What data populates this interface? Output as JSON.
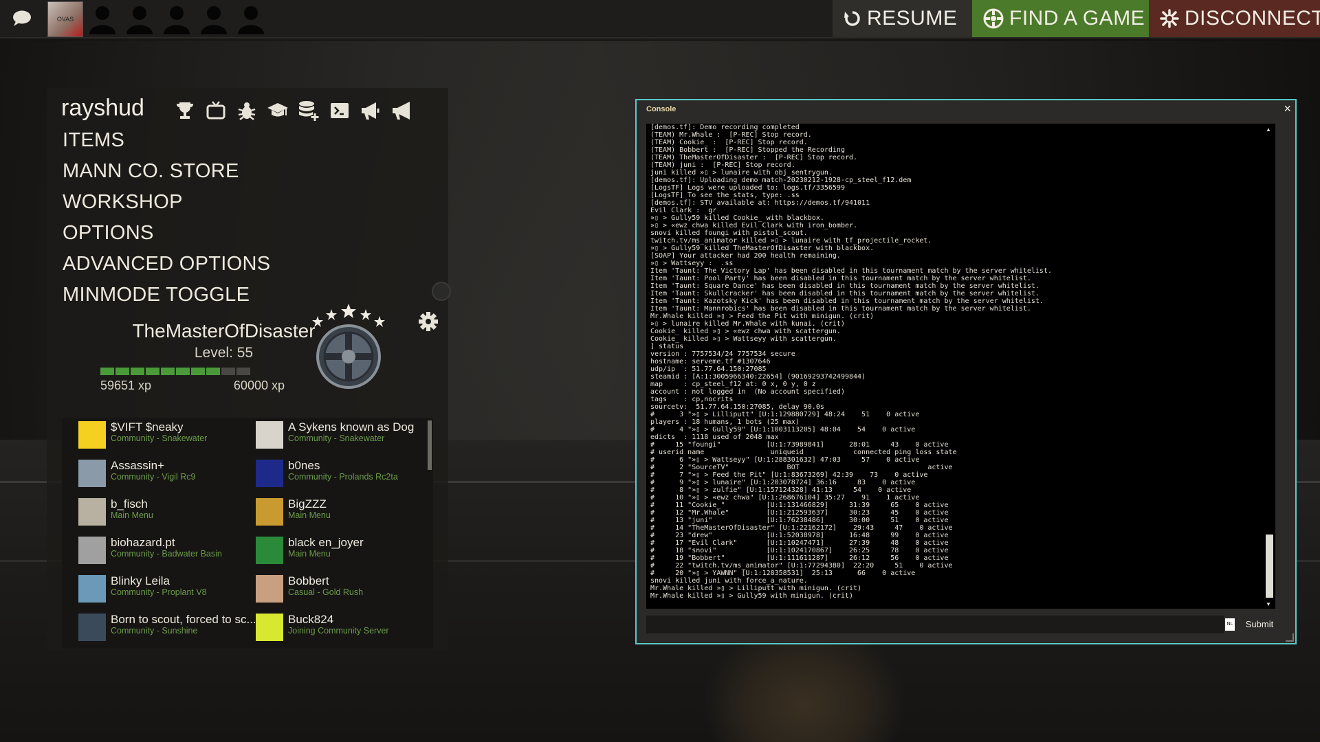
{
  "topbar": {
    "resume_label": "RESUME",
    "find_game_label": "FIND A GAME",
    "disconnect_label": "DISCONNECT",
    "avatar_text": "OVAS",
    "colors": {
      "resume": "#2f2e2b",
      "find": "#4a7a2a",
      "disconnect": "#5a2a22"
    }
  },
  "menu": {
    "username": "rayshud",
    "icons": [
      "trophy-icon",
      "tv-icon",
      "bug-icon",
      "graduation-cap-icon",
      "database-add-icon",
      "terminal-icon",
      "megaphone-icon",
      "megaphone-alt-icon"
    ],
    "items": [
      "ITEMS",
      "MANN CO. STORE",
      "WORKSHOP",
      "OPTIONS",
      "ADVANCED OPTIONS",
      "MINMODE TOGGLE"
    ]
  },
  "player": {
    "name": "TheMasterOfDisaster",
    "level": "Level: 55",
    "xp_current": "59651 xp",
    "xp_next": "60000 xp",
    "xp_progress": 0.8,
    "xp_segments": 10
  },
  "friends": [
    {
      "name": "$VIFT $neaky",
      "status": "Community - Snakewater",
      "avatar_color": "#f5d020"
    },
    {
      "name": "A Sykens known as Dog",
      "status": "Community - Snakewater",
      "avatar_color": "#d8d4cc"
    },
    {
      "name": "Assassin+",
      "status": "Community - Vigil Rc9",
      "avatar_color": "#8a9aa8"
    },
    {
      "name": "b0nes",
      "status": "Community - Prolands Rc2ta",
      "avatar_color": "#1e2a8a"
    },
    {
      "name": "b_fisch",
      "status": "Main Menu",
      "avatar_color": "#b8b0a0"
    },
    {
      "name": "BigZZZ",
      "status": "Main Menu",
      "avatar_color": "#c89a30"
    },
    {
      "name": "biohazard.pt",
      "status": "Community - Badwater Basin",
      "avatar_color": "#a0a0a0"
    },
    {
      "name": "black en_joyer",
      "status": "Main Menu",
      "avatar_color": "#2a8a3a"
    },
    {
      "name": "Blinky Leila",
      "status": "Community - Proplant V8",
      "avatar_color": "#6a9ab8"
    },
    {
      "name": "Bobbert",
      "status": "Casual - Gold Rush",
      "avatar_color": "#c8a080"
    },
    {
      "name": "Born to scout, forced to sc...",
      "status": "Community - Sunshine",
      "avatar_color": "#3a4a5a"
    },
    {
      "name": "Buck824",
      "status": "Joining Community Server",
      "avatar_color": "#d8e830"
    }
  ],
  "console": {
    "title": "Console",
    "close": "×",
    "nl_label": "NL",
    "submit_label": "Submit",
    "lines": [
      "[demos.tf]: Demo recording completed",
      "(TEAM) Mr.Whale :  [P-REC] Stop record.",
      "(TEAM) Cookie_ :  [P-REC] Stop record.",
      "(TEAM) Bobbert :  [P-REC] Stopped the Recording",
      "(TEAM) TheMasterOfDisaster :  [P-REC] Stop record.",
      "(TEAM) juni :  [P-REC] Stop record.",
      "juni killed »▯ > lunaire with obj_sentrygun.",
      "[demos.tf]: Uploading demo match-20230212-1928-cp_steel_f12.dem",
      "[LogsTF] Logs were uploaded to: logs.tf/3356599",
      "[LogsTF] To see the stats, type: .ss",
      "[demos.tf]: STV available at: https://demos.tf/941011",
      "Evil Clark :  gr",
      "»▯ > Gully59 killed Cookie_ with blackbox.",
      "»▯ > «ewz chwa killed Evil Clark with iron_bomber.",
      "snovi killed foungi with pistol_scout.",
      "twitch.tv/ms_animator killed »▯ > lunaire with tf_projectile_rocket.",
      "»▯ > Gully59 killed TheMasterOfDisaster with blackbox.",
      "[SOAP] Your attacker had 200 health remaining.",
      "»▯ > Wattseyy :  .ss",
      "Item 'Taunt: The Victory Lap' has been disabled in this tournament match by the server whitelist.",
      "Item 'Taunt: Pool Party' has been disabled in this tournament match by the server whitelist.",
      "Item 'Taunt: Square Dance' has been disabled in this tournament match by the server whitelist.",
      "Item 'Taunt: Skullcracker' has been disabled in this tournament match by the server whitelist.",
      "Item 'Taunt: Kazotsky Kick' has been disabled in this tournament match by the server whitelist.",
      "Item 'Taunt: Mannrobics' has been disabled in this tournament match by the server whitelist.",
      "Mr.Whale killed »▯ > Feed the Pit with minigun. (crit)",
      "»▯ > lunaire killed Mr.Whale with kunai. (crit)",
      "Cookie_ killed »▯ > «ewz chwa with scattergun.",
      "Cookie_ killed »▯ > Wattseyy with scattergun.",
      "] status",
      "version : 7757534/24 7757534 secure",
      "hostname: serveme.tf #1307646",
      "udp/ip  : 51.77.64.150:27085",
      "steamid : [A:1:3005966340:22654] (90169293742499844)",
      "map     : cp_steel_f12 at: 0 x, 0 y, 0 z",
      "account : not logged in  (No account specified)",
      "tags    : cp,nocrits",
      "sourcetv:  51.77.64.150:27085, delay 90.0s",
      "#      3 \"»▯ > Lilliputt\" [U:1:129880729] 48:24    51    0 active",
      "players : 18 humans, 1 bots (25 max)",
      "#      4 \"»▯ > Gully59\" [U:1:1003113205] 48:04    54    0 active",
      "edicts  : 1118 used of 2048 max",
      "#     15 \"foungi\"           [U:1:73989841]      28:01     43    0 active",
      "# userid name                uniqueid            connected ping loss state",
      "#      6 \"»▯ > Wattseyy\" [U:1:288301632] 47:03     57    0 active",
      "#      2 \"SourceTV\"              BOT                               active",
      "#      7 \"»▯ > Feed the Pit\" [U:1:83673269] 42:39    73    0 active",
      "#      9 \"»▯ > lunaire\" [U:1:203078724] 36:16     83    0 active",
      "#      8 \"»▯ > zulfie\" [U:1:157124328] 41:13     54    0 active",
      "#     10 \"»▯ > «ewz chwa\" [U:1:268676104] 35:27    91    1 active",
      "#     11 \"Cookie_\"          [U:1:131466829]     31:39     65    0 active",
      "#     12 \"Mr.Whale\"         [U:1:212593637]     30:23     45    0 active",
      "#     13 \"juni\"             [U:1:76238486]      30:00     51    0 active",
      "#     14 \"TheMasterOfDisaster\" [U:1:22162172]    29:43     47    0 active",
      "#     23 \"drew\"             [U:1:52038978]      16:48     99    0 active",
      "#     17 \"Evil Clark\"       [U:1:10247471]      27:39     48    0 active",
      "#     18 \"snovi\"            [U:1:1024170867]    26:25     78    0 active",
      "#     19 \"Bobbert\"          [U:1:111611287]     26:12     56    0 active",
      "#     22 \"twitch.tv/ms_animator\" [U:1:77294380]  22:20     51    0 active",
      "#     20 \"»▯ > YAWNN\" [U:1:128358531]  25:13      66    0 active",
      "snovi killed juni with force_a_nature.",
      "Mr.Whale killed »▯ > Lilliputt with minigun. (crit)",
      "Mr.Whale killed »▯ > Gully59 with minigun. (crit)"
    ]
  }
}
